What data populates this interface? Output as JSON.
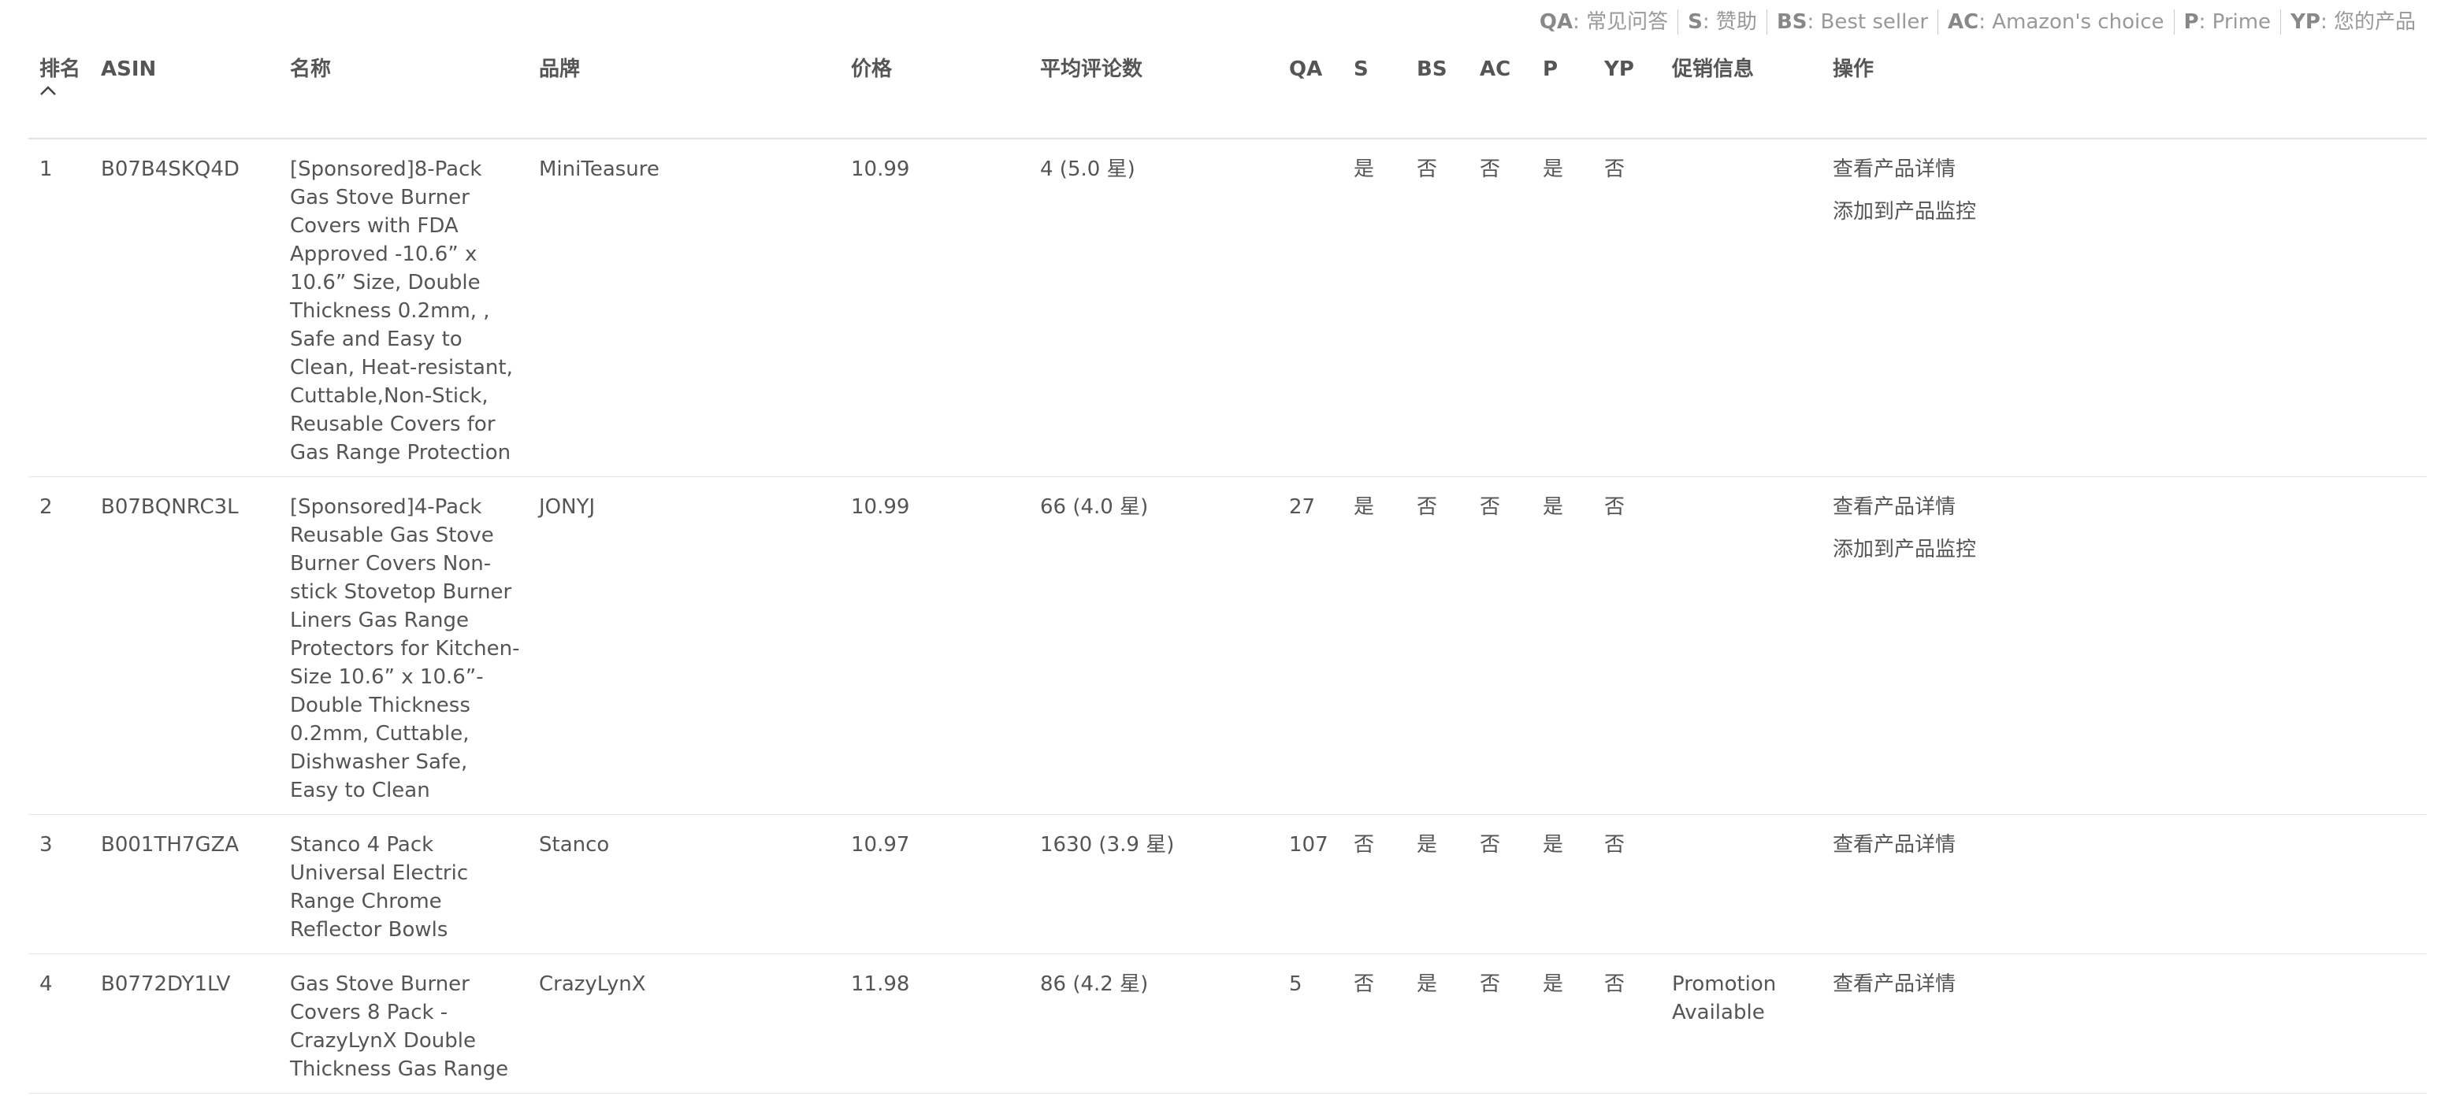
{
  "legend": [
    {
      "key": "QA",
      "desc": "常见问答"
    },
    {
      "key": "S",
      "desc": "赞助"
    },
    {
      "key": "BS",
      "desc": "Best seller"
    },
    {
      "key": "AC",
      "desc": "Amazon's choice"
    },
    {
      "key": "P",
      "desc": "Prime"
    },
    {
      "key": "YP",
      "desc": "您的产品"
    }
  ],
  "table": {
    "headers": {
      "rank": "排名",
      "rank_sort_icon": "chevron-up-icon",
      "asin": "ASIN",
      "name": "名称",
      "brand": "品牌",
      "price": "价格",
      "reviews": "平均评论数",
      "qa": "QA",
      "s": "S",
      "bs": "BS",
      "ac": "AC",
      "p": "P",
      "yp": "YP",
      "promo": "促销信息",
      "actions": "操作"
    },
    "rows": [
      {
        "rank": "1",
        "asin": "B07B4SKQ4D",
        "name": "[Sponsored]8-Pack Gas Stove Burner Covers with FDA Approved -10.6” x 10.6” Size, Double Thickness 0.2mm, , Safe and Easy to Clean, Heat-resistant, Cuttable,Non-Stick, Reusable Covers for Gas Range Protection",
        "brand": "MiniTeasure",
        "price": "10.99",
        "reviews": "4 (5.0 星)",
        "qa": "",
        "s": "是",
        "bs": "否",
        "ac": "否",
        "p": "是",
        "yp": "否",
        "promo": "",
        "actions": [
          "查看产品详情",
          "添加到产品监控"
        ]
      },
      {
        "rank": "2",
        "asin": "B07BQNRC3L",
        "name": "[Sponsored]4-Pack Reusable Gas Stove Burner Covers Non-stick Stovetop Burner Liners Gas Range Protectors for Kitchen-Size 10.6” x 10.6”-Double Thickness 0.2mm, Cuttable, Dishwasher Safe, Easy to Clean",
        "brand": "JONYJ",
        "price": "10.99",
        "reviews": "66 (4.0 星)",
        "qa": "27",
        "s": "是",
        "bs": "否",
        "ac": "否",
        "p": "是",
        "yp": "否",
        "promo": "",
        "actions": [
          "查看产品详情",
          "添加到产品监控"
        ]
      },
      {
        "rank": "3",
        "asin": "B001TH7GZA",
        "name": "Stanco 4 Pack Universal Electric Range Chrome Reflector Bowls",
        "brand": "Stanco",
        "price": "10.97",
        "reviews": "1630 (3.9 星)",
        "qa": "107",
        "s": "否",
        "bs": "是",
        "ac": "否",
        "p": "是",
        "yp": "否",
        "promo": "",
        "actions": [
          "查看产品详情"
        ]
      },
      {
        "rank": "4",
        "asin": "B0772DY1LV",
        "name": "Gas Stove Burner Covers 8 Pack - CrazyLynX Double Thickness Gas Range",
        "brand": "CrazyLynX",
        "price": "11.98",
        "reviews": "86 (4.2 星)",
        "qa": "5",
        "s": "否",
        "bs": "是",
        "ac": "否",
        "p": "是",
        "yp": "否",
        "promo": "Promotion Available",
        "actions": [
          "查看产品详情"
        ]
      }
    ]
  }
}
